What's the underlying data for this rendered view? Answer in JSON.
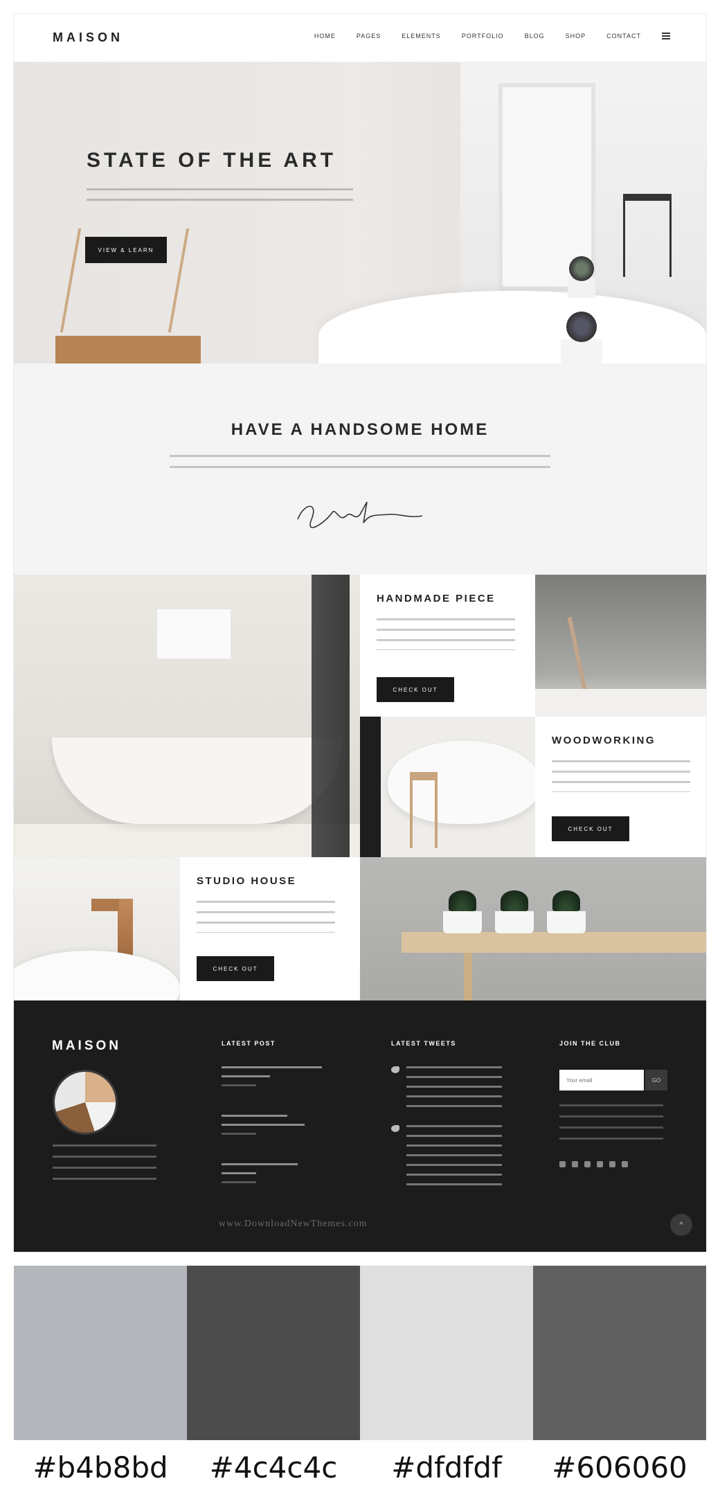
{
  "header": {
    "logo": "MAISON",
    "nav": [
      "HOME",
      "PAGES",
      "ELEMENTS",
      "PORTFOLIO",
      "BLOG",
      "SHOP",
      "CONTACT"
    ]
  },
  "hero": {
    "title": "STATE OF THE ART",
    "button": "VIEW & LEARN"
  },
  "intro": {
    "title": "HAVE A HANDSOME HOME"
  },
  "tiles": {
    "handmade": {
      "title": "HANDMADE PIECE",
      "button": "CHECK OUT"
    },
    "woodworking": {
      "title": "WOODWORKING",
      "button": "CHECK OUT"
    },
    "studio": {
      "title": "STUDIO HOUSE",
      "button": "CHECK OUT"
    }
  },
  "footer": {
    "logo": "MAISON",
    "latest_post": "LATEST POST",
    "latest_tweets": "LATEST TWEETS",
    "join": "JOIN THE CLUB",
    "input_placeholder": "Your email",
    "input_button": "GO",
    "watermark": "www.DownloadNewThemes.com",
    "back_to_top": "^"
  },
  "palette": {
    "colors": [
      "#b4b8bd",
      "#4c4c4c",
      "#dfdfdf",
      "#606060"
    ],
    "codes": [
      "#b4b8bd",
      "#4c4c4c",
      "#dfdfdf",
      "#606060"
    ]
  }
}
